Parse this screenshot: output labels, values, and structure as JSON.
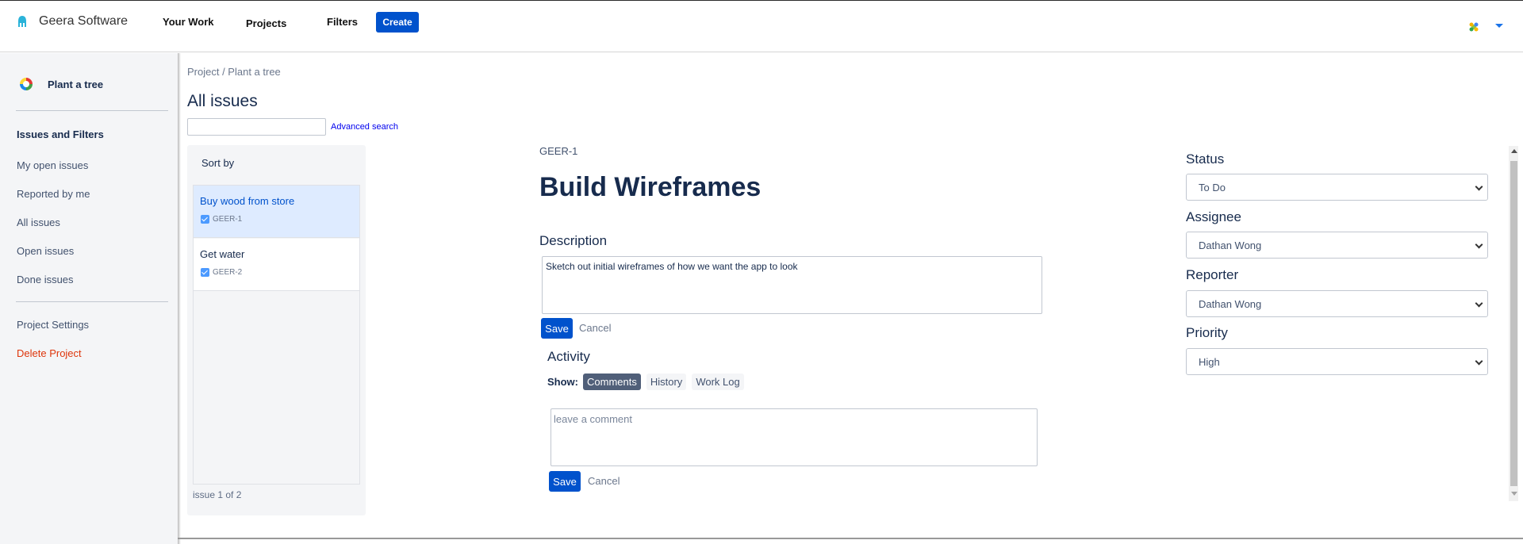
{
  "app": {
    "brand": "Geera Software",
    "brand_icon": "geera-logo-icon",
    "nav": [
      "Your Work",
      "Projects",
      "Filters"
    ],
    "create_label": "Create",
    "user_icon": "user-avatar-icon",
    "accent": "#0052cc"
  },
  "sidebar": {
    "project_name": "Plant a tree",
    "project_icon": "project-icon",
    "heading": "Issues and Filters",
    "items": [
      "My open issues",
      "Reported by me",
      "All issues",
      "Open issues",
      "Done issues"
    ],
    "settings_label": "Project Settings",
    "delete_label": "Delete Project",
    "danger_color": "#de350b"
  },
  "main": {
    "breadcrumb": "Project / Plant a tree",
    "title": "All issues",
    "search_value": "",
    "advanced_search": "Advanced search",
    "sort_label": "Sort by",
    "issues": [
      {
        "title": "Buy wood from store",
        "key": "GEER-1",
        "selected": true
      },
      {
        "title": "Get water",
        "key": "GEER-2",
        "selected": false
      }
    ],
    "count": "issue 1 of 2"
  },
  "detail": {
    "key": "GEER-1",
    "title": "Build Wireframes",
    "description_label": "Description",
    "description": "Sketch out initial wireframes of how we want the app to look",
    "save": "Save",
    "cancel": "Cancel",
    "activity_label": "Activity",
    "show_label": "Show:",
    "tabs": [
      "Comments",
      "History",
      "Work Log"
    ],
    "active_tab": "Comments",
    "comment_placeholder": "leave a comment"
  },
  "fields": {
    "status_label": "Status",
    "status_value": "To Do",
    "assignee_label": "Assignee",
    "assignee_value": "Dathan Wong",
    "reporter_label": "Reporter",
    "reporter_value": "Dathan Wong",
    "priority_label": "Priority",
    "priority_value": "High"
  }
}
